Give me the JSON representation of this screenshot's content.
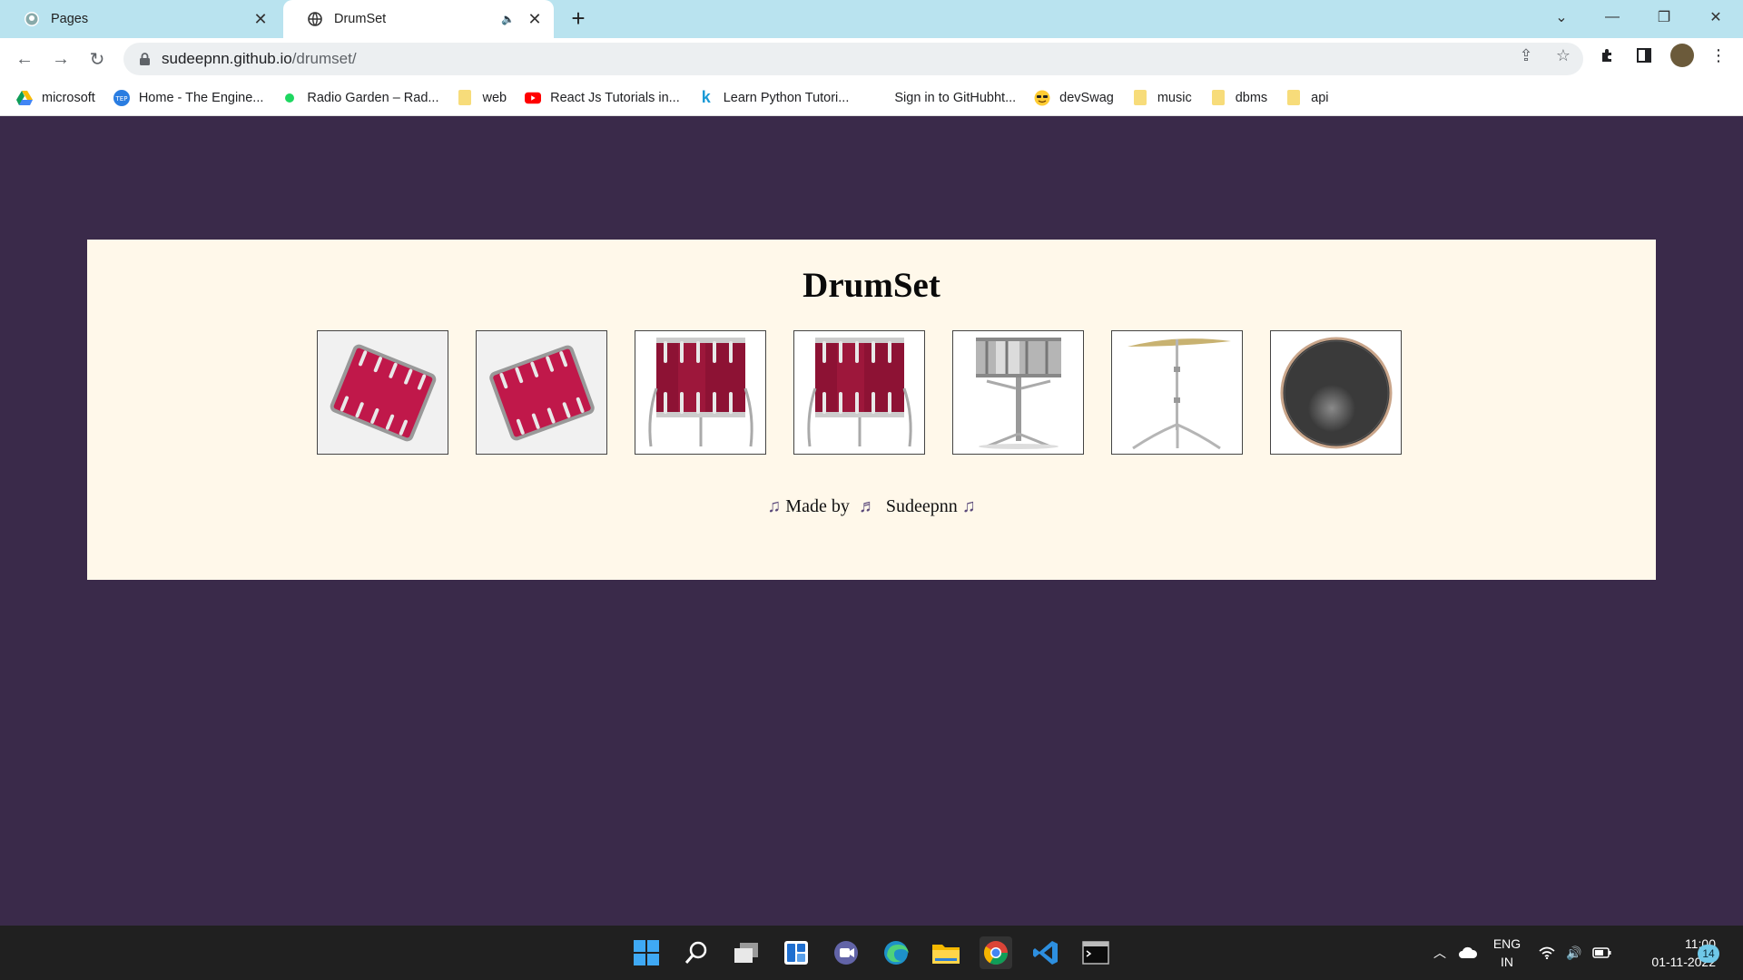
{
  "browser": {
    "tabs": [
      {
        "title": "Pages",
        "icon": "github-icon",
        "active": false
      },
      {
        "title": "DrumSet",
        "icon": "globe-icon",
        "active": true
      }
    ],
    "new_tab_label": "+",
    "url_host": "sudeepnn.github.io",
    "url_path": "/drumset/",
    "bookmarks": [
      {
        "label": "microsoft",
        "icon": "google-drive-icon"
      },
      {
        "label": "Home - The Engine...",
        "icon": "tep-icon"
      },
      {
        "label": "Radio Garden – Rad...",
        "icon": "green-dot-icon"
      },
      {
        "label": "web",
        "icon": "folder-icon"
      },
      {
        "label": "React Js Tutorials in...",
        "icon": "youtube-icon"
      },
      {
        "label": "Learn Python Tutori...",
        "icon": "k-icon"
      },
      {
        "label": "Sign in to GitHubht...",
        "icon": "none"
      },
      {
        "label": "devSwag",
        "icon": "sunglasses-emoji-icon"
      },
      {
        "label": "music",
        "icon": "folder-icon"
      },
      {
        "label": "dbms",
        "icon": "folder-icon"
      },
      {
        "label": "api",
        "icon": "folder-icon"
      }
    ]
  },
  "page": {
    "heading": "DrumSet",
    "drums": [
      {
        "name": "tom-1",
        "kind": "tom-tilted"
      },
      {
        "name": "tom-2",
        "kind": "tom-tilted"
      },
      {
        "name": "tom-3",
        "kind": "floor-tom"
      },
      {
        "name": "tom-4",
        "kind": "floor-tom"
      },
      {
        "name": "snare",
        "kind": "snare"
      },
      {
        "name": "crash",
        "kind": "cymbal"
      },
      {
        "name": "kick",
        "kind": "bass-drum"
      }
    ],
    "footer": {
      "made_by": "Made by",
      "author": "Sudeepnn"
    }
  },
  "taskbar": {
    "lang_line1": "ENG",
    "lang_line2": "IN",
    "time": "11:00",
    "date": "01-11-2022",
    "notifications": "14"
  },
  "colors": {
    "page_background": "#3a2a4a",
    "card_background": "#fff8ea",
    "tabstrip": "#b9e3ef",
    "drum_red": "#b0173f"
  }
}
